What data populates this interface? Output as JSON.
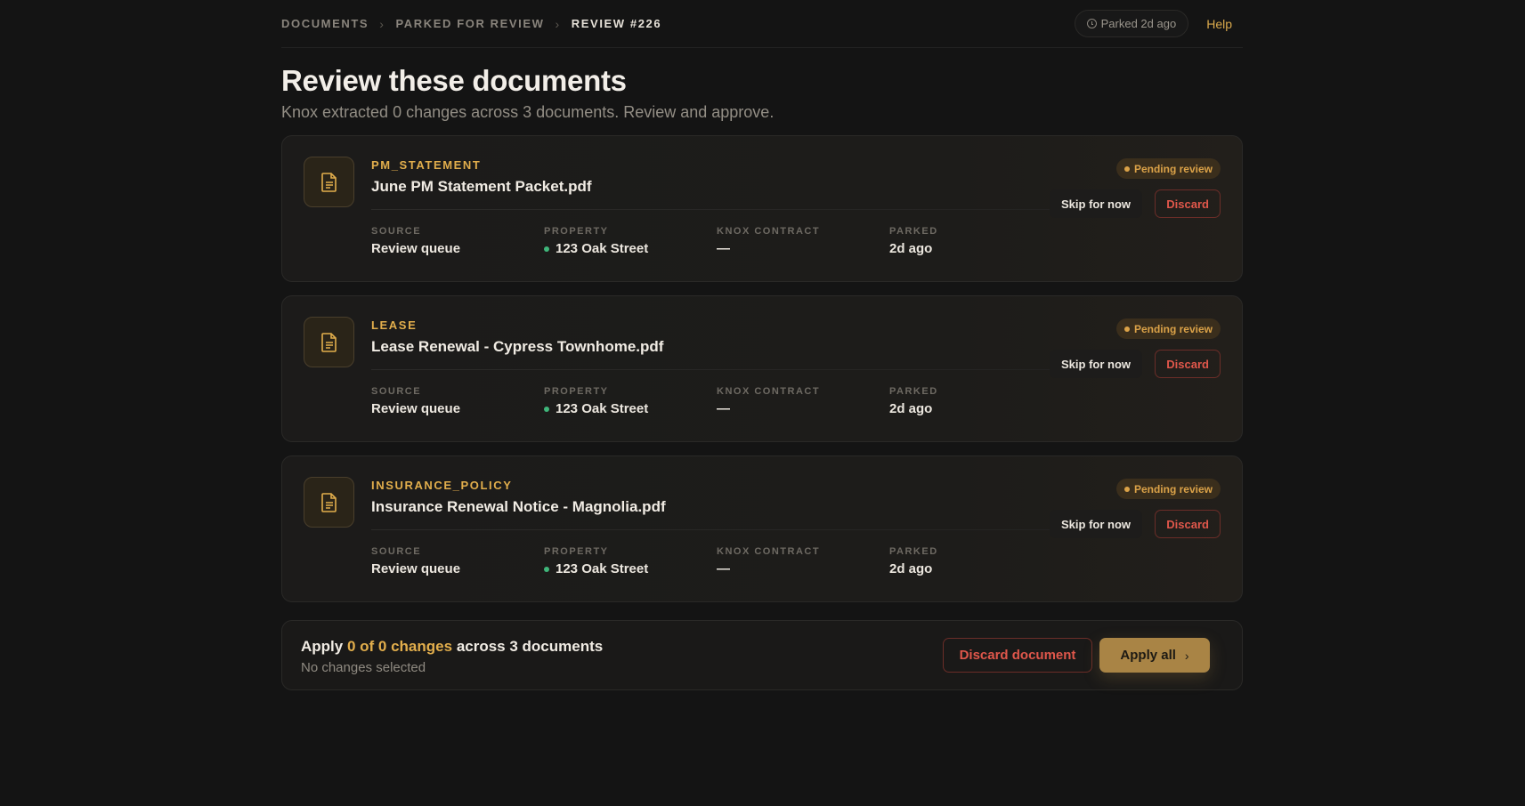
{
  "breadcrumb": {
    "items": [
      "DOCUMENTS",
      "PARKED FOR REVIEW",
      "REVIEW #226"
    ]
  },
  "header": {
    "parked_label": "Parked 2d ago",
    "help_label": "Help"
  },
  "page": {
    "title": "Review these documents",
    "subtitle": "Knox extracted 0 changes across 3 documents. Review and approve."
  },
  "meta_labels": {
    "source": "SOURCE",
    "property": "PROPERTY",
    "contract": "KNOX CONTRACT",
    "parked": "PARKED"
  },
  "documents": [
    {
      "type": "PM_STATEMENT",
      "name": "June PM Statement Packet.pdf",
      "status": "Pending review",
      "source": "Review queue",
      "property": "123 Oak Street",
      "contract": "—",
      "parked": "2d ago",
      "skip_label": "Skip for now",
      "discard_label": "Discard"
    },
    {
      "type": "LEASE",
      "name": "Lease Renewal - Cypress Townhome.pdf",
      "status": "Pending review",
      "source": "Review queue",
      "property": "123 Oak Street",
      "contract": "—",
      "parked": "2d ago",
      "skip_label": "Skip for now",
      "discard_label": "Discard"
    },
    {
      "type": "INSURANCE_POLICY",
      "name": "Insurance Renewal Notice - Magnolia.pdf",
      "status": "Pending review",
      "source": "Review queue",
      "property": "123 Oak Street",
      "contract": "—",
      "parked": "2d ago",
      "skip_label": "Skip for now",
      "discard_label": "Discard"
    }
  ],
  "footer": {
    "apply_prefix": "Apply",
    "apply_highlight": "0 of 0 changes",
    "apply_suffix": "across 3 documents",
    "sub": "No changes selected",
    "discard_doc_label": "Discard document",
    "apply_all_label": "Apply all"
  },
  "colors": {
    "accent": "#e2ae4c",
    "danger": "#e0574b",
    "property_dot": "#3fb67a",
    "background": "#141414"
  }
}
